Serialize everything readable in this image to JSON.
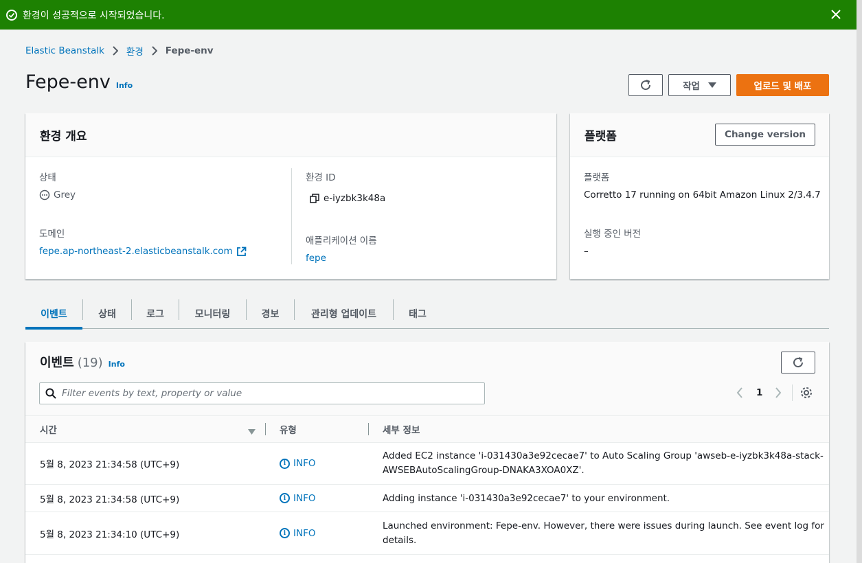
{
  "flash": {
    "message": "환경이 성공적으로 시작되었습니다."
  },
  "breadcrumb": {
    "root": "Elastic Beanstalk",
    "middle": "환경",
    "current": "Fepe-env"
  },
  "header": {
    "title": "Fepe-env",
    "info": "Info",
    "actions_label": "작업",
    "deploy_label": "업로드 및 배포"
  },
  "overview": {
    "title": "환경 개요",
    "status_label": "상태",
    "status_value": "Grey",
    "domain_label": "도메인",
    "domain_value": "fepe.ap-northeast-2.elasticbeanstalk.com",
    "env_id_label": "환경 ID",
    "env_id_value": "e-iyzbk3k48a",
    "app_name_label": "애플리케이션 이름",
    "app_name_value": "fepe"
  },
  "platform": {
    "title": "플랫폼",
    "change_version": "Change version",
    "platform_label": "플랫폼",
    "platform_value": "Corretto 17 running on 64bit Amazon Linux 2/3.4.7",
    "running_version_label": "실행 중인 버전",
    "running_version_value": "–"
  },
  "tabs": [
    "이벤트",
    "상태",
    "로그",
    "모니터링",
    "경보",
    "관리형 업데이트",
    "태그"
  ],
  "events": {
    "title": "이벤트",
    "count": "(19)",
    "info": "Info",
    "search_placeholder": "Filter events by text, property or value",
    "page": "1",
    "columns": {
      "time": "시간",
      "type": "유형",
      "details": "세부 정보"
    },
    "rows": [
      {
        "time": "5월 8, 2023 21:34:58 (UTC+9)",
        "type": "INFO",
        "details_1": "Added EC2 instance 'i-031430a3e92cecae7' to Auto Scaling Group 'awseb-e-iyzbk3k48a-stack-",
        "details_2": "AWSEBAutoScalingGroup-DNAKA3XOA0XZ'."
      },
      {
        "time": "5월 8, 2023 21:34:58 (UTC+9)",
        "type": "INFO",
        "details_1": "Adding instance 'i-031430a3e92cecae7' to your environment.",
        "details_2": ""
      },
      {
        "time": "5월 8, 2023 21:34:10 (UTC+9)",
        "type": "INFO",
        "details_1": "Launched environment: Fepe-env. However, there were issues during launch. See event log for",
        "details_2": "details."
      }
    ]
  },
  "colors": {
    "success": "#1d8102",
    "primary": "#ec7211",
    "link": "#0073bb"
  }
}
